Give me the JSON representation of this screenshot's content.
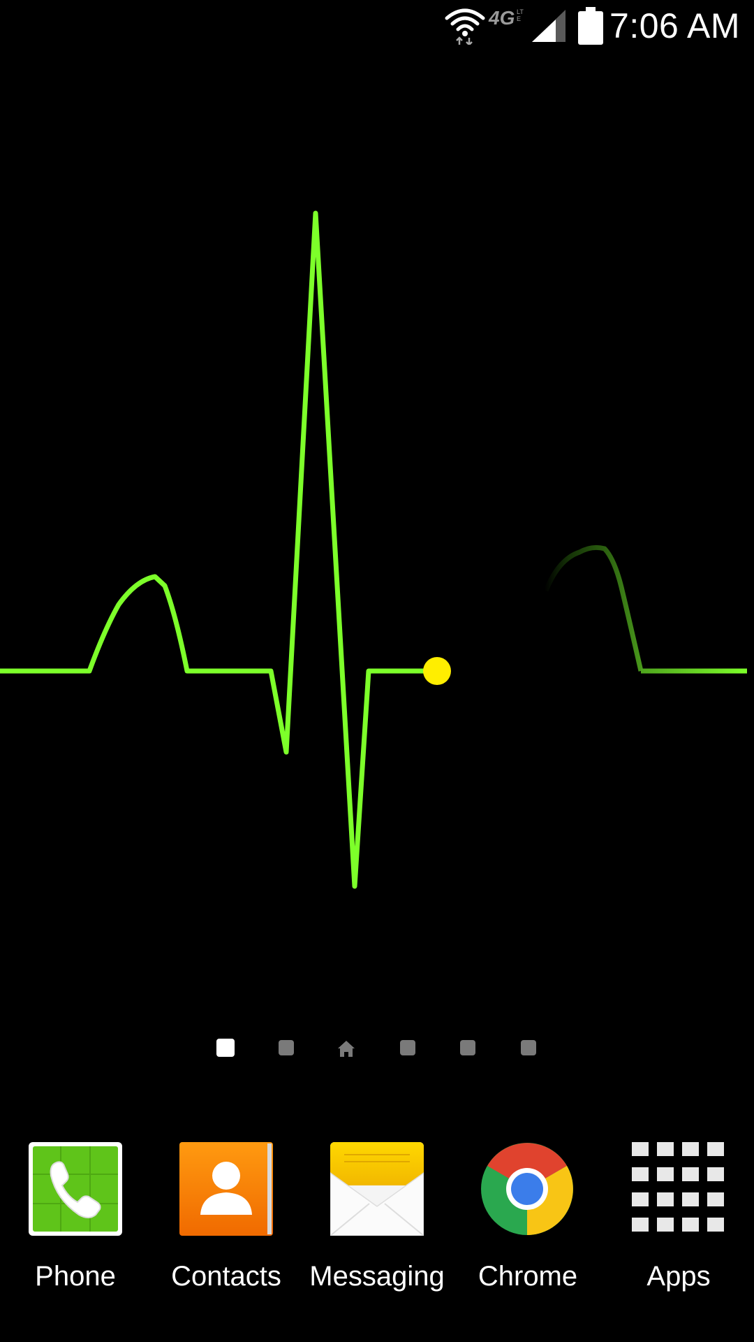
{
  "status_bar": {
    "time": "7:06 AM",
    "network_badge": "4G",
    "network_sub": "LTE",
    "icons": [
      "wifi-icon",
      "lte-icon",
      "signal-icon",
      "battery-icon"
    ]
  },
  "wallpaper": {
    "name": "heartbeat-ecg-live-wallpaper",
    "line_color": "#7dff2a",
    "cursor_color": "#ffee00"
  },
  "page_indicator": {
    "pages": 6,
    "active_index": 0,
    "home_index": 2
  },
  "dock": {
    "items": [
      {
        "label": "Phone",
        "icon": "phone-icon"
      },
      {
        "label": "Contacts",
        "icon": "contacts-icon"
      },
      {
        "label": "Messaging",
        "icon": "messaging-icon"
      },
      {
        "label": "Chrome",
        "icon": "chrome-icon"
      },
      {
        "label": "Apps",
        "icon": "apps-grid-icon"
      }
    ]
  }
}
